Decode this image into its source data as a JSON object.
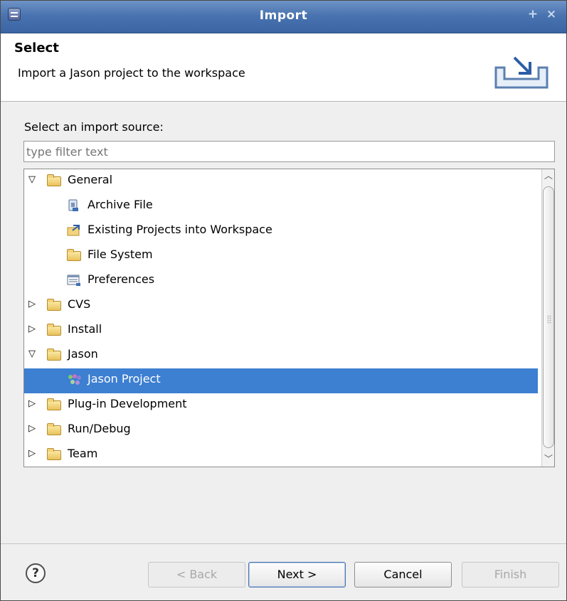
{
  "window": {
    "title": "Import",
    "controls": [
      "+",
      "×"
    ]
  },
  "header": {
    "title": "Select",
    "description": "Import a Jason project to the workspace"
  },
  "source": {
    "label": "Select an import source:",
    "filter_placeholder": "type filter text"
  },
  "tree": {
    "items": [
      {
        "label": "General",
        "expanded": true,
        "level": 0
      },
      {
        "label": "Archive File",
        "level": 1,
        "icon": "archive-file-icon"
      },
      {
        "label": "Existing Projects into Workspace",
        "level": 1,
        "icon": "existing-projects-icon"
      },
      {
        "label": "File System",
        "level": 1,
        "icon": "file-system-icon"
      },
      {
        "label": "Preferences",
        "level": 1,
        "icon": "preferences-icon"
      },
      {
        "label": "CVS",
        "expanded": false,
        "level": 0
      },
      {
        "label": "Install",
        "expanded": false,
        "level": 0
      },
      {
        "label": "Jason",
        "expanded": true,
        "level": 0
      },
      {
        "label": "Jason Project",
        "level": 1,
        "selected": true,
        "icon": "jason-project-icon"
      },
      {
        "label": "Plug-in Development",
        "expanded": false,
        "level": 0
      },
      {
        "label": "Run/Debug",
        "expanded": false,
        "level": 0
      },
      {
        "label": "Team",
        "expanded": false,
        "level": 0
      }
    ]
  },
  "buttons": {
    "help": "?",
    "back": "< Back",
    "next": "Next >",
    "cancel": "Cancel",
    "finish": "Finish"
  },
  "colors": {
    "titlebar": "#4a74b0",
    "selection": "#3d7fd1"
  }
}
